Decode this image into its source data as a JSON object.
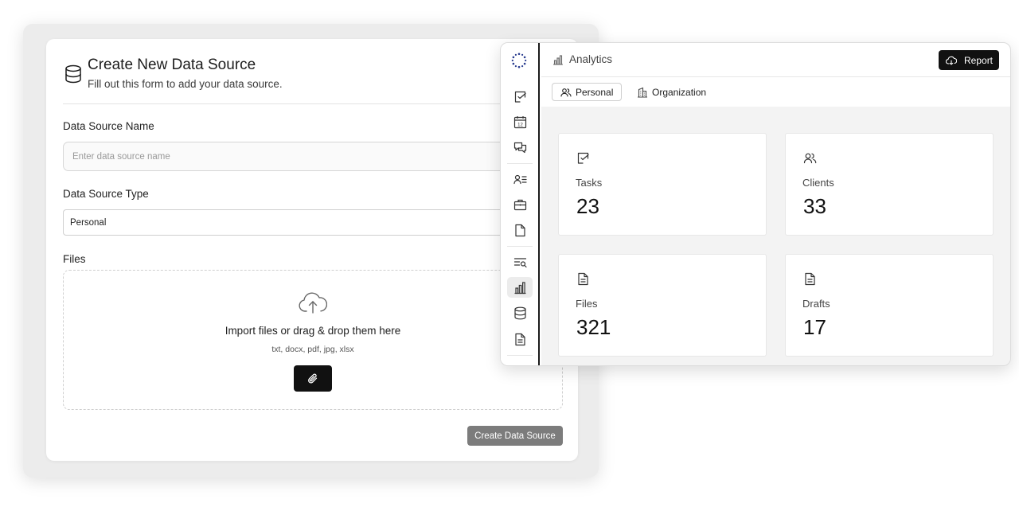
{
  "form": {
    "title": "Create New Data Source",
    "subtitle": "Fill out this form to add your data source.",
    "name_label": "Data Source Name",
    "name_placeholder": "Enter data source name",
    "type_label": "Data Source Type",
    "type_value": "Personal",
    "files_label": "Files",
    "drop_text": "Import files or drag & drop them here",
    "drop_types": "txt, docx, pdf, jpg, xlsx",
    "submit_label": "Create Data Source"
  },
  "analytics": {
    "title": "Analytics",
    "report_label": "Report",
    "tabs": [
      {
        "label": "Personal",
        "active": true
      },
      {
        "label": "Organization",
        "active": false
      }
    ],
    "sidebar_icons": [
      "tasks-icon",
      "calendar-icon",
      "chat-icon",
      "contacts-icon",
      "briefcase-icon",
      "file-icon",
      "search-list-icon",
      "analytics-icon",
      "database-icon",
      "document-icon"
    ],
    "calendar_day": "12",
    "stats": [
      {
        "label": "Tasks",
        "value": "23",
        "icon": "tasks-icon"
      },
      {
        "label": "Clients",
        "value": "33",
        "icon": "users-icon"
      },
      {
        "label": "Files",
        "value": "321",
        "icon": "document-icon"
      },
      {
        "label": "Drafts",
        "value": "17",
        "icon": "document-icon"
      }
    ]
  },
  "colors": {
    "primary_button": "#111111",
    "disabled_button": "#7c7c7c",
    "frame_background": "#ececec"
  }
}
